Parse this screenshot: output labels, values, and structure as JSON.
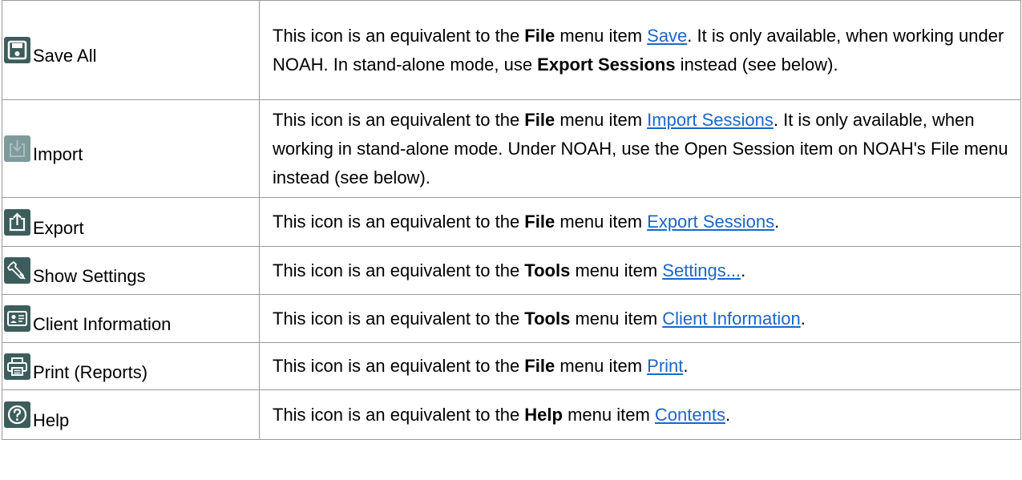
{
  "rows": [
    {
      "icon": "save-icon",
      "label": "Save All",
      "desc": {
        "pre": "This icon is an equivalent to the ",
        "menu": "File",
        "mid": " menu item ",
        "link": "Save",
        "post1": ". It is only available, when working under NOAH. In stand-alone mode, use ",
        "bold2": "Export Sessions",
        "post2": " instead (see below)."
      }
    },
    {
      "icon": "import-icon",
      "label": "Import",
      "desc": {
        "pre": "This icon is an equivalent to the ",
        "menu": "File",
        "mid": " menu item ",
        "link": "Import Sessions",
        "post": ". It is only available, when working in stand-alone mode. Under NOAH, use the Open Session item on NOAH's File menu instead (see below)."
      }
    },
    {
      "icon": "export-icon",
      "label": "Export",
      "desc": {
        "pre": "This icon is an equivalent to the ",
        "menu": "File",
        "mid": " menu item ",
        "link": "Export Sessions",
        "post": "."
      }
    },
    {
      "icon": "wrench-icon",
      "label": "Show Settings",
      "desc": {
        "pre": "This icon is an equivalent to the ",
        "menu": "Tools",
        "mid": " menu item ",
        "link": "Settings...",
        "post": "."
      }
    },
    {
      "icon": "client-card-icon",
      "label": "Client Information",
      "desc": {
        "pre": "This icon is an equivalent to the ",
        "menu": "Tools",
        "mid": " menu item ",
        "link": "Client Information",
        "post": "."
      }
    },
    {
      "icon": "printer-icon",
      "label": "Print (Reports)",
      "desc": {
        "pre": "This icon is an equivalent to the ",
        "menu": "File",
        "mid": " menu item ",
        "link": "Print",
        "post": "."
      }
    },
    {
      "icon": "help-icon",
      "label": "Help",
      "desc": {
        "pre": "This icon is an equivalent to the ",
        "menu": "Help",
        "mid": " menu item ",
        "link": "Contents",
        "post": "."
      }
    }
  ],
  "colors": {
    "icon_bg": "#3d5d5d",
    "icon_bg_disabled": "#7e9a9a",
    "link": "#1b66c8",
    "border": "#9a9a9a"
  }
}
